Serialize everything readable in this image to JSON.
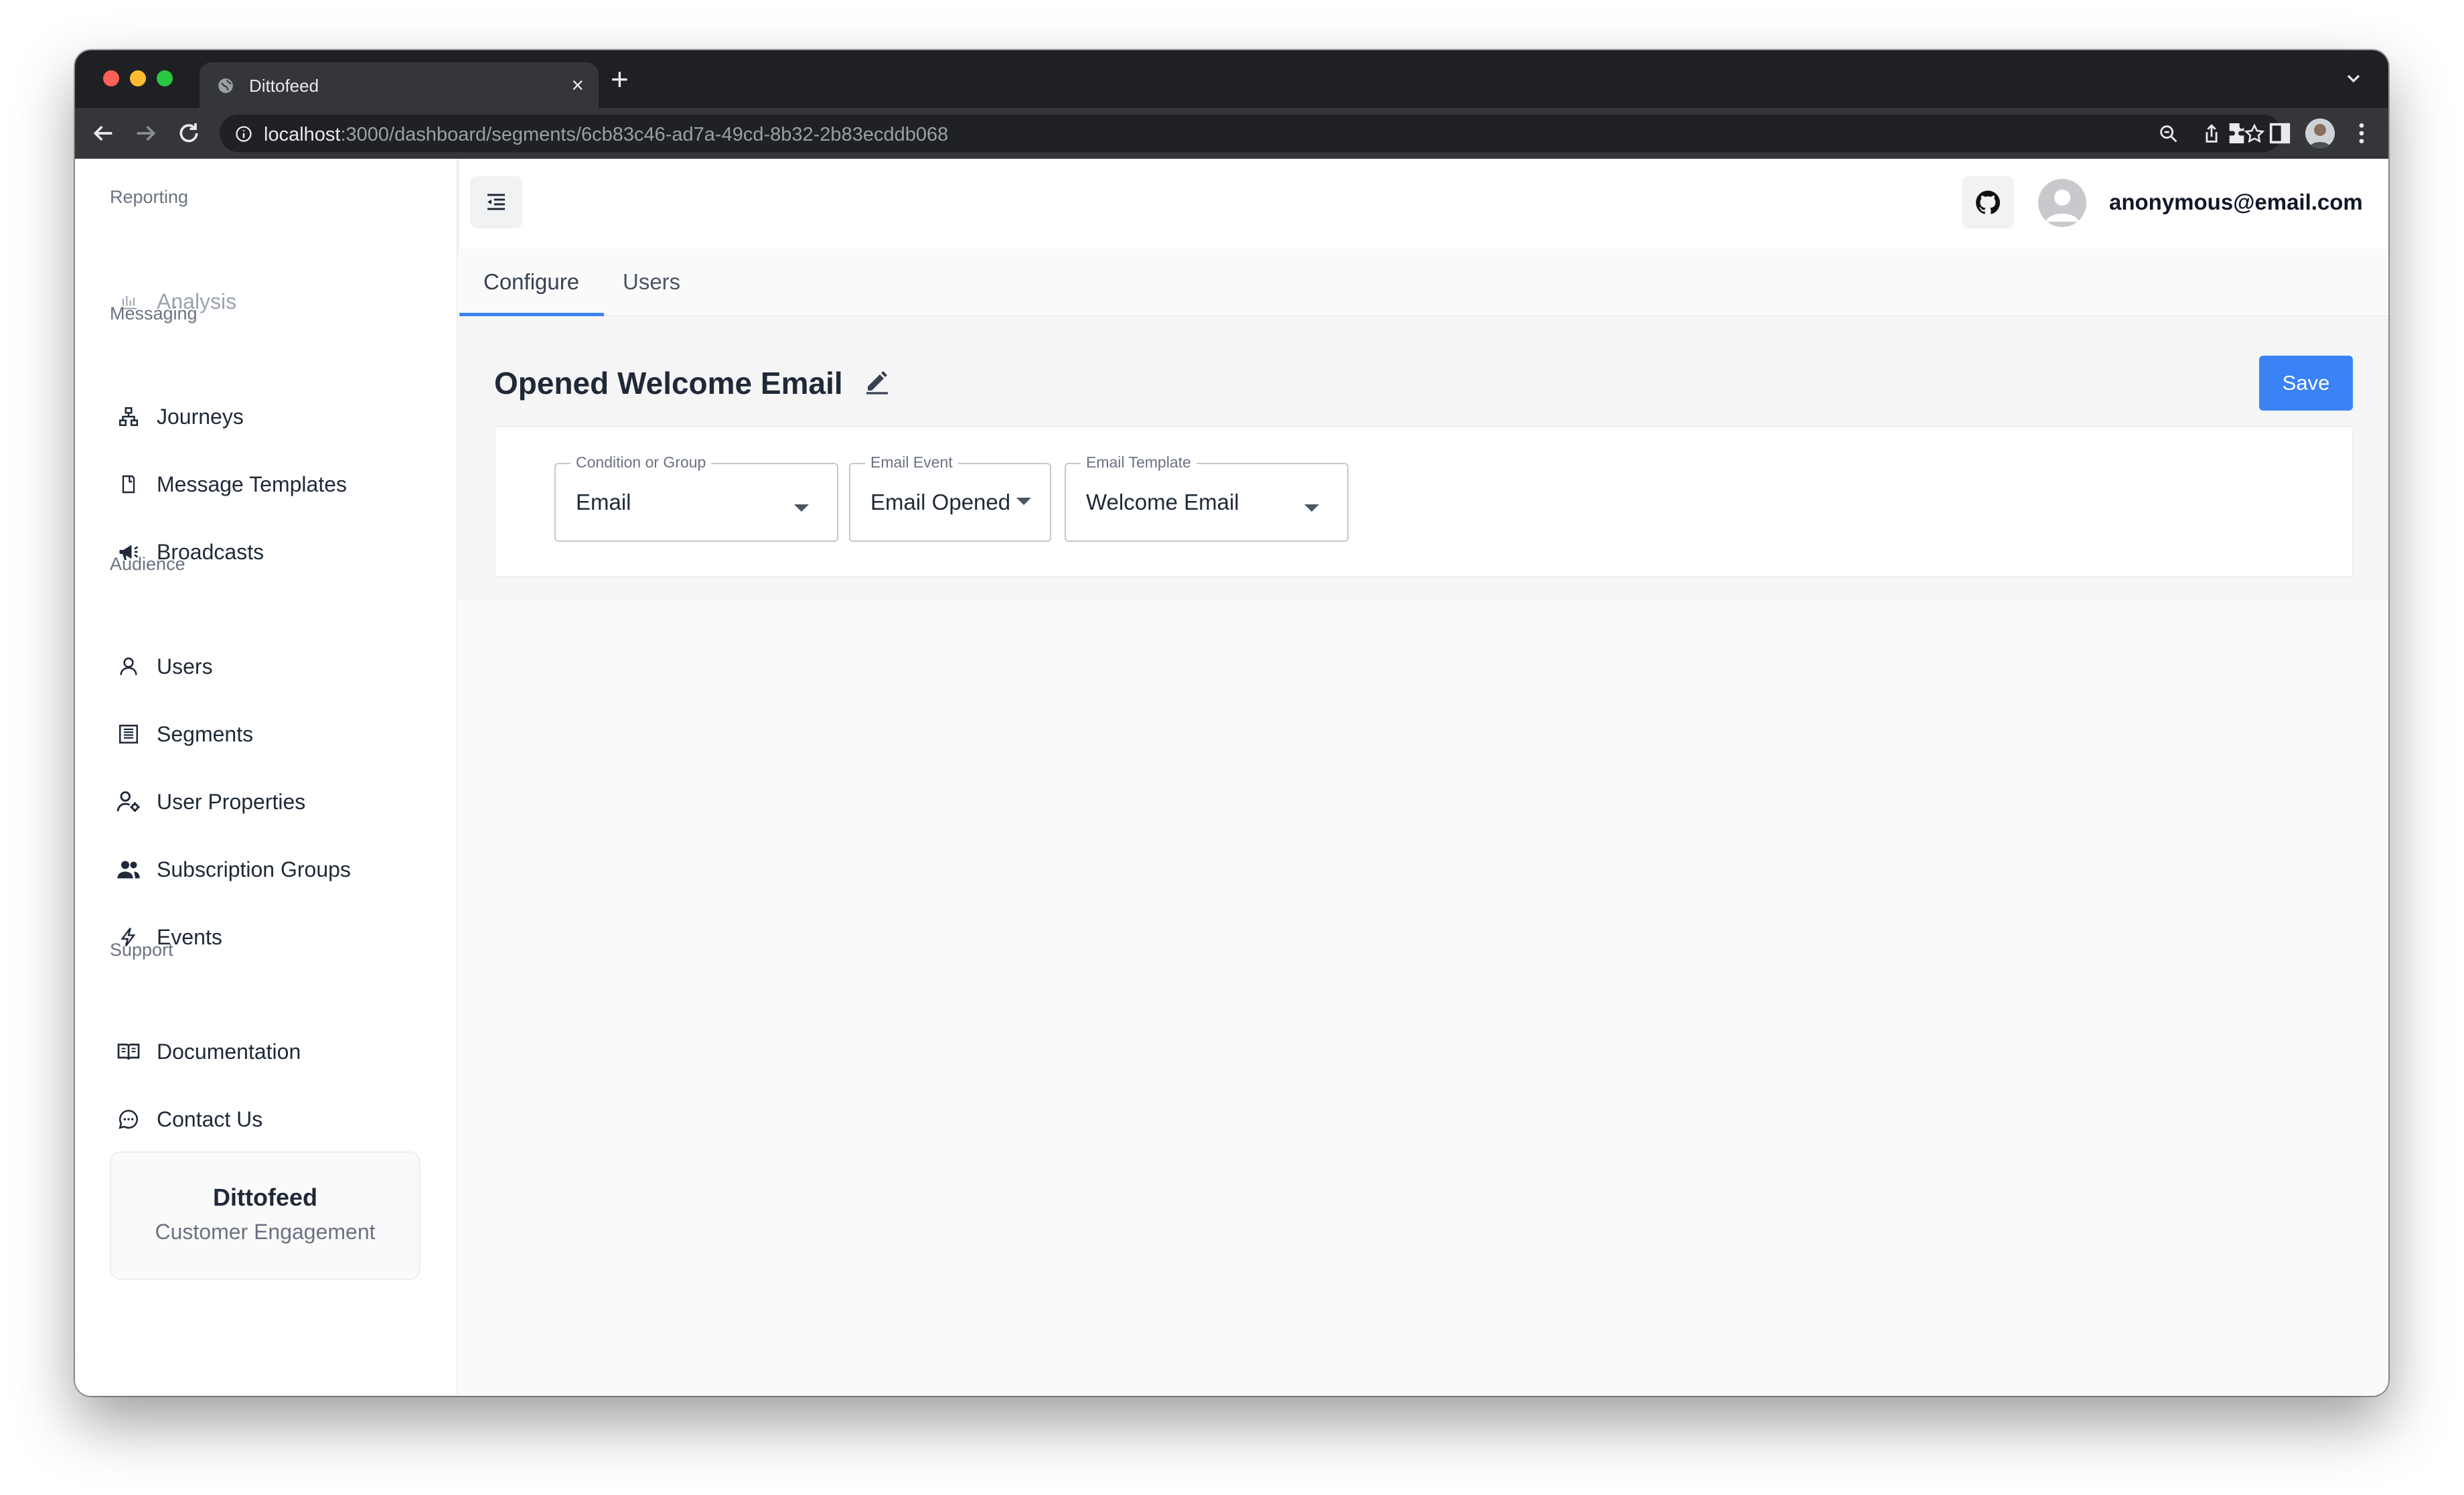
{
  "browser": {
    "tab_title": "Dittofeed",
    "tab_close": "×",
    "new_tab": "+",
    "url_host": "localhost",
    "url_path": ":3000/dashboard/segments/6cb83c46-ad7a-49cd-8b32-2b83ecddb068"
  },
  "sidebar": {
    "sections": [
      {
        "label": "Reporting"
      },
      {
        "label": "Messaging"
      },
      {
        "label": "Audience"
      },
      {
        "label": "Support"
      }
    ],
    "items": [
      {
        "label": "Analysis",
        "icon": "bar-chart-icon",
        "disabled": true
      },
      {
        "label": "Journeys",
        "icon": "sitemap-icon"
      },
      {
        "label": "Message Templates",
        "icon": "document-icon"
      },
      {
        "label": "Broadcasts",
        "icon": "megaphone-icon"
      },
      {
        "label": "Users",
        "icon": "user-icon"
      },
      {
        "label": "Segments",
        "icon": "segments-icon"
      },
      {
        "label": "User Properties",
        "icon": "user-gear-icon"
      },
      {
        "label": "Subscription Groups",
        "icon": "team-icon"
      },
      {
        "label": "Events",
        "icon": "thunderbolt-icon"
      },
      {
        "label": "Documentation",
        "icon": "book-icon"
      },
      {
        "label": "Contact Us",
        "icon": "chat-icon"
      }
    ],
    "brand": {
      "name": "Dittofeed",
      "tagline": "Customer Engagement"
    }
  },
  "header": {
    "user_email": "anonymous@email.com"
  },
  "tabs": [
    {
      "label": "Configure",
      "active": true
    },
    {
      "label": "Users",
      "active": false
    }
  ],
  "segment": {
    "title": "Opened Welcome Email",
    "save_label": "Save",
    "fields": [
      {
        "label": "Condition or Group",
        "value": "Email"
      },
      {
        "label": "Email Event",
        "value": "Email Opened"
      },
      {
        "label": "Email Template",
        "value": "Welcome Email"
      }
    ]
  },
  "colors": {
    "accent": "#3b82f6",
    "browser_frame": "#1f2023",
    "browser_toolbar": "#35363a"
  }
}
